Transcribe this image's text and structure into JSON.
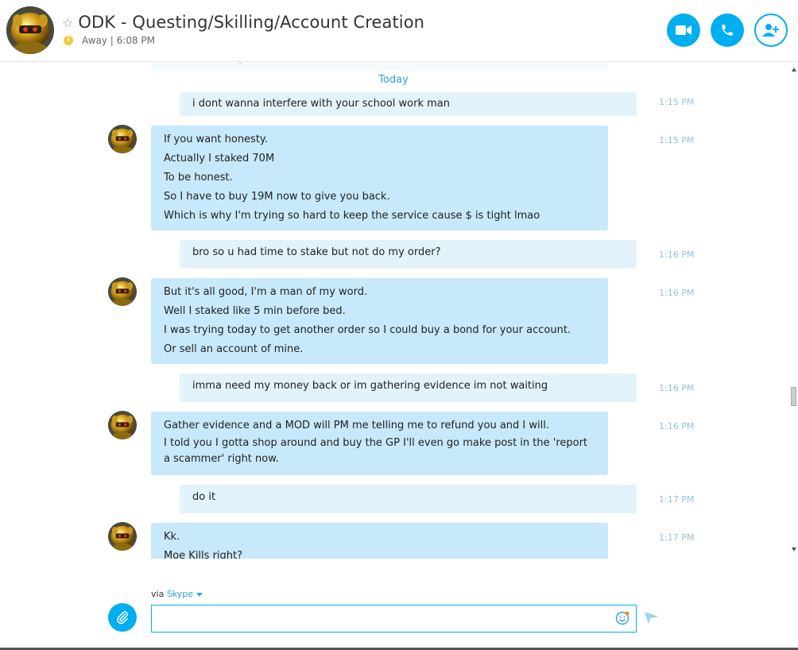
{
  "header": {
    "title": "ODK - Questing/Skilling/Account Creation",
    "status": "Away | 6:08 PM",
    "star_icon": "star-outline-icon",
    "video_button": "video-call-icon",
    "call_button": "phone-icon",
    "add_button": "add-contact-icon"
  },
  "chat": {
    "faded_previous": "the GP I had might not",
    "date_divider": "Today",
    "messages": [
      {
        "dir": "out",
        "time": "1:15 PM",
        "lines": [
          "i dont wanna interfere with your school work man"
        ]
      },
      {
        "dir": "in",
        "time": "1:15 PM",
        "lines": [
          "If you want honesty.",
          "Actually I staked 70M",
          "To be honest.",
          "So I have to buy 19M now to give you back.",
          "Which is why I'm trying so hard to keep the service cause $ is tight lmao"
        ]
      },
      {
        "dir": "out",
        "time": "1:16 PM",
        "lines": [
          "bro so u had time to stake but not do my order?"
        ]
      },
      {
        "dir": "in",
        "time": "1:16 PM",
        "lines": [
          "But it's all good, I'm a man of my word.",
          "Well I staked like 5 min before bed.",
          "I was trying today to get another order so I could buy a bond for your account.",
          "Or sell an account of mine."
        ]
      },
      {
        "dir": "out",
        "time": "1:16 PM",
        "lines": [
          "imma need my money back or im gathering evidence im not waiting"
        ]
      },
      {
        "dir": "in",
        "time": "1:16 PM",
        "lines": [
          "Gather evidence and a MOD will PM me telling me to refund you and I will.",
          "I told you I gotta shop around and buy the GP I'll even go make post in the 'report a scammer' right now."
        ]
      },
      {
        "dir": "out",
        "time": "1:17 PM",
        "lines": [
          "do it"
        ]
      },
      {
        "dir": "in",
        "time": "1:17 PM",
        "lines": [
          "Kk.",
          "Moe Kills right?"
        ]
      }
    ]
  },
  "compose": {
    "via_label": "via",
    "via_service": "Skype",
    "input_value": "",
    "input_placeholder": "",
    "attach_icon": "paperclip-icon",
    "emoji_icon": "emoji-icon",
    "send_icon": "send-icon"
  },
  "colors": {
    "accent": "#00aff0",
    "incoming_bubble": "#c7e9fb",
    "outgoing_bubble": "#e3f3fc",
    "timestamp": "#8fc3de",
    "status_away": "#f6c73b"
  }
}
